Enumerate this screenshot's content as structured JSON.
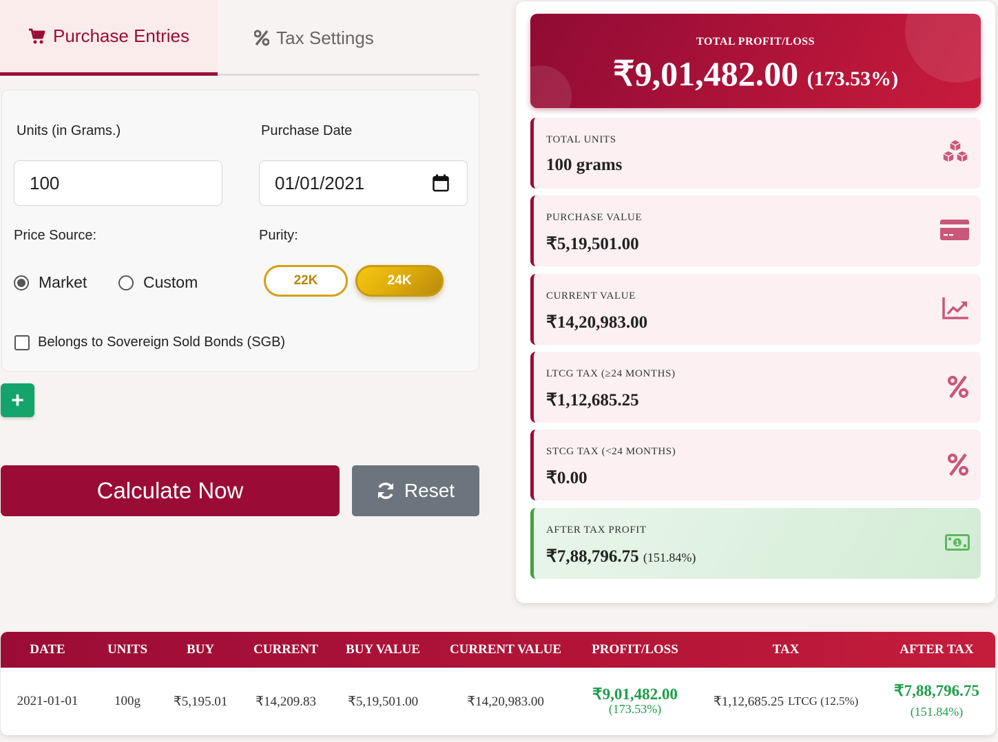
{
  "tabs": {
    "purchase": "Purchase Entries",
    "tax": "Tax Settings"
  },
  "form": {
    "units_label": "Units (in Grams.)",
    "units_value": "100",
    "date_label": "Purchase Date",
    "date_value": "01/01/2021",
    "price_source_label": "Price Source:",
    "market_label": "Market",
    "custom_label": "Custom",
    "price_source_selected": "Market",
    "purity_label": "Purity:",
    "purity_22": "22K",
    "purity_24": "24K",
    "purity_selected": "24K",
    "sgb_label": "Belongs to Sovereign Sold Bonds (SGB)",
    "sgb_checked": false
  },
  "buttons": {
    "add": "+",
    "calculate": "Calculate Now",
    "reset": "Reset"
  },
  "summary": {
    "total_label": "TOTAL PROFIT/LOSS",
    "total_value": "₹9,01,482.00",
    "total_pct": "(173.53%)",
    "stats": [
      {
        "label": "TOTAL UNITS",
        "value": "100 grams",
        "icon": "cubes-icon"
      },
      {
        "label": "PURCHASE VALUE",
        "value": "₹5,19,501.00",
        "icon": "credit-card-icon"
      },
      {
        "label": "CURRENT VALUE",
        "value": "₹14,20,983.00",
        "icon": "chart-line-icon"
      },
      {
        "label": "LTCG TAX (≥24 MONTHS)",
        "value": "₹1,12,685.25",
        "icon": "percent-icon"
      },
      {
        "label": "STCG TAX (<24 MONTHS)",
        "value": "₹0.00",
        "icon": "percent-icon"
      }
    ],
    "after_tax": {
      "label": "AFTER TAX PROFIT",
      "value": "₹7,88,796.75",
      "pct": "(151.84%)",
      "icon": "money-bill-icon"
    }
  },
  "colors": {
    "primary": "#9a0c36",
    "gold": "#d4a017",
    "success": "#12a46b",
    "secondary": "#6c757d"
  },
  "table": {
    "headers": [
      "DATE",
      "UNITS",
      "BUY",
      "CURRENT",
      "BUY VALUE",
      "CURRENT VALUE",
      "PROFIT/LOSS",
      "TAX",
      "AFTER TAX"
    ],
    "rows": [
      {
        "date": "2021-01-01",
        "units": "100g",
        "buy": "₹5,195.01",
        "current": "₹14,209.83",
        "buy_value": "₹5,19,501.00",
        "current_value": "₹14,20,983.00",
        "profit": "₹9,01,482.00",
        "profit_pct": "(173.53%)",
        "tax": "₹1,12,685.25",
        "tax_note": "LTCG (12.5%)",
        "after_tax": "₹7,88,796.75",
        "after_tax_pct": "(151.84%)"
      }
    ]
  }
}
